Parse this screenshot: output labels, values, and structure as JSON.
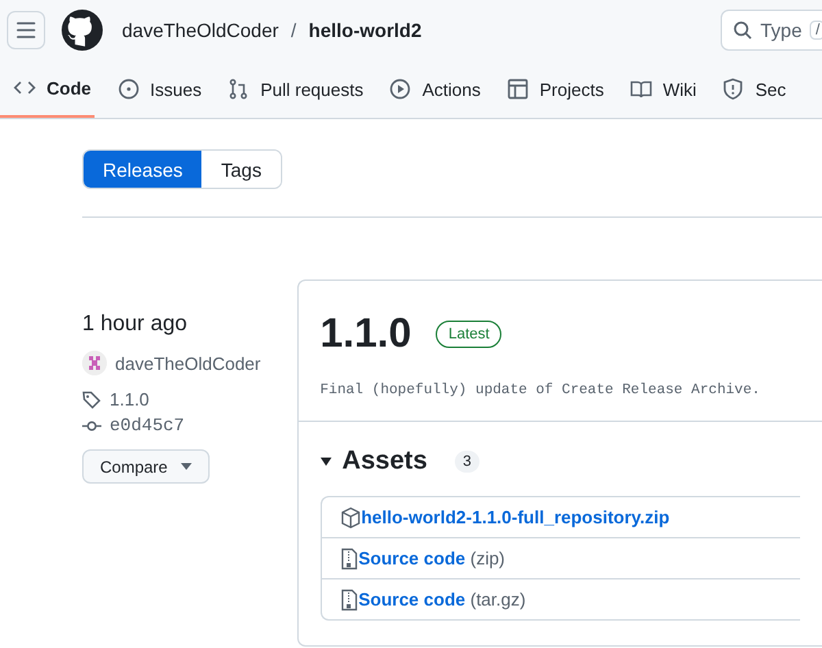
{
  "header": {
    "owner": "daveTheOldCoder",
    "separator": "/",
    "repo": "hello-world2",
    "search": {
      "placeholder": "Type",
      "shortcut": "/"
    }
  },
  "tabs": [
    {
      "label": "Code",
      "selected": true
    },
    {
      "label": "Issues",
      "selected": false
    },
    {
      "label": "Pull requests",
      "selected": false
    },
    {
      "label": "Actions",
      "selected": false
    },
    {
      "label": "Projects",
      "selected": false
    },
    {
      "label": "Wiki",
      "selected": false
    },
    {
      "label": "Sec",
      "selected": false
    }
  ],
  "switcher": [
    {
      "label": "Releases",
      "selected": true
    },
    {
      "label": "Tags",
      "selected": false
    }
  ],
  "release": {
    "time": "1 hour ago",
    "author": "daveTheOldCoder",
    "tag": "1.1.0",
    "commit": "e0d45c7",
    "compare": "Compare",
    "version": "1.1.0",
    "badge": "Latest",
    "description": "Final (hopefully) update of Create Release Archive.",
    "assets_title": "Assets",
    "assets_count": "3",
    "assets": [
      {
        "kind": "package",
        "name": "hello-world2-1.1.0-full_repository.zip"
      },
      {
        "kind": "source",
        "name": "Source code",
        "format": "(zip)"
      },
      {
        "kind": "source",
        "name": "Source code",
        "format": "(tar.gz)"
      }
    ]
  }
}
